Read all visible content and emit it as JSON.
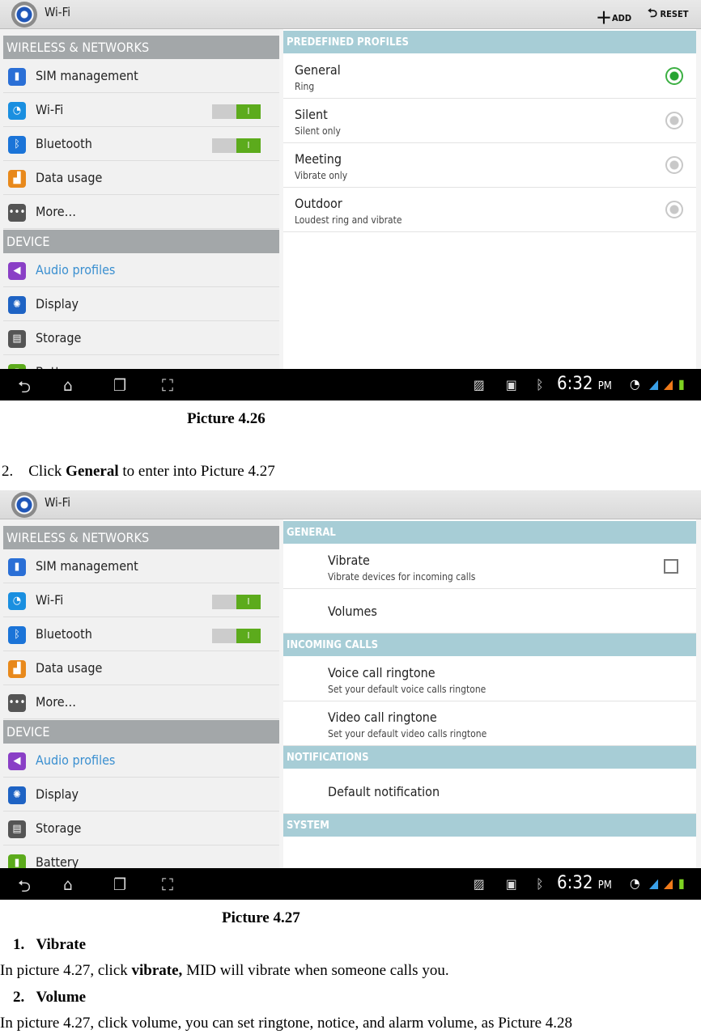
{
  "shot1": {
    "title": "Wi-Fi",
    "add": "ADD",
    "reset": "RESET",
    "left": [
      {
        "type": "header",
        "label": "WIRELESS & NETWORKS"
      },
      {
        "label": "SIM management",
        "icon": "sim-icon",
        "color": "#2a6fd6"
      },
      {
        "label": "Wi-Fi",
        "icon": "wifi-icon",
        "color": "#1a8fe0",
        "toggle": "I"
      },
      {
        "label": "Bluetooth",
        "icon": "bluetooth-icon",
        "color": "#1b74d8",
        "toggle": "I"
      },
      {
        "label": "Data usage",
        "icon": "data-usage-icon",
        "color": "#e8891c"
      },
      {
        "label": "More…",
        "icon": "more-icon",
        "color": "#555"
      },
      {
        "type": "header",
        "label": "DEVICE"
      },
      {
        "label": "Audio profiles",
        "icon": "audio-icon",
        "color": "#8a3fc6",
        "selected": true
      },
      {
        "label": "Display",
        "icon": "display-icon",
        "color": "#1e63c4"
      },
      {
        "label": "Storage",
        "icon": "storage-icon",
        "color": "#555"
      },
      {
        "label": "Battery",
        "icon": "battery-icon",
        "color": "#5cab1c"
      }
    ],
    "right": [
      {
        "type": "header",
        "label": "PREDEFINED PROFILES"
      },
      {
        "title": "General",
        "sub": "Ring",
        "radio": true,
        "checked": true
      },
      {
        "title": "Silent",
        "sub": "Silent only",
        "radio": true,
        "checked": false
      },
      {
        "title": "Meeting",
        "sub": "Vibrate only",
        "radio": true,
        "checked": false
      },
      {
        "title": "Outdoor",
        "sub": "Loudest ring and vibrate",
        "radio": true,
        "checked": false
      }
    ],
    "time": "6:32",
    "ampm": "PM"
  },
  "caption1": "Picture 4.26",
  "step2": {
    "num": "2.",
    "pre": "Click ",
    "bold": "General",
    "post": " to enter into Picture 4.27"
  },
  "shot2": {
    "title": "Wi-Fi",
    "right": [
      {
        "type": "header",
        "label": "GENERAL"
      },
      {
        "title": "Vibrate",
        "sub": "Vibrate devices for incoming calls",
        "checkbox": true
      },
      {
        "title": "Volumes"
      },
      {
        "type": "header",
        "label": "INCOMING CALLS"
      },
      {
        "title": "Voice call ringtone",
        "sub": "Set your default voice calls ringtone"
      },
      {
        "title": "Video call ringtone",
        "sub": "Set your default video calls ringtone"
      },
      {
        "type": "header",
        "label": "NOTIFICATIONS"
      },
      {
        "title": "Default notification"
      },
      {
        "type": "header",
        "label": "SYSTEM"
      }
    ],
    "time": "6:32",
    "ampm": "PM"
  },
  "caption2": "Picture 4.27",
  "items": [
    {
      "num": "1.",
      "title": "Vibrate",
      "pre": "In picture 4.27, click ",
      "bold": "vibrate,",
      "post": " MID will vibrate when someone calls you."
    },
    {
      "num": "2.",
      "title": "Volume",
      "pre": "In picture 4.27, click volume, you can set ringtone, notice, and alarm volume, as Picture 4.28",
      "bold": "",
      "post": ""
    }
  ]
}
